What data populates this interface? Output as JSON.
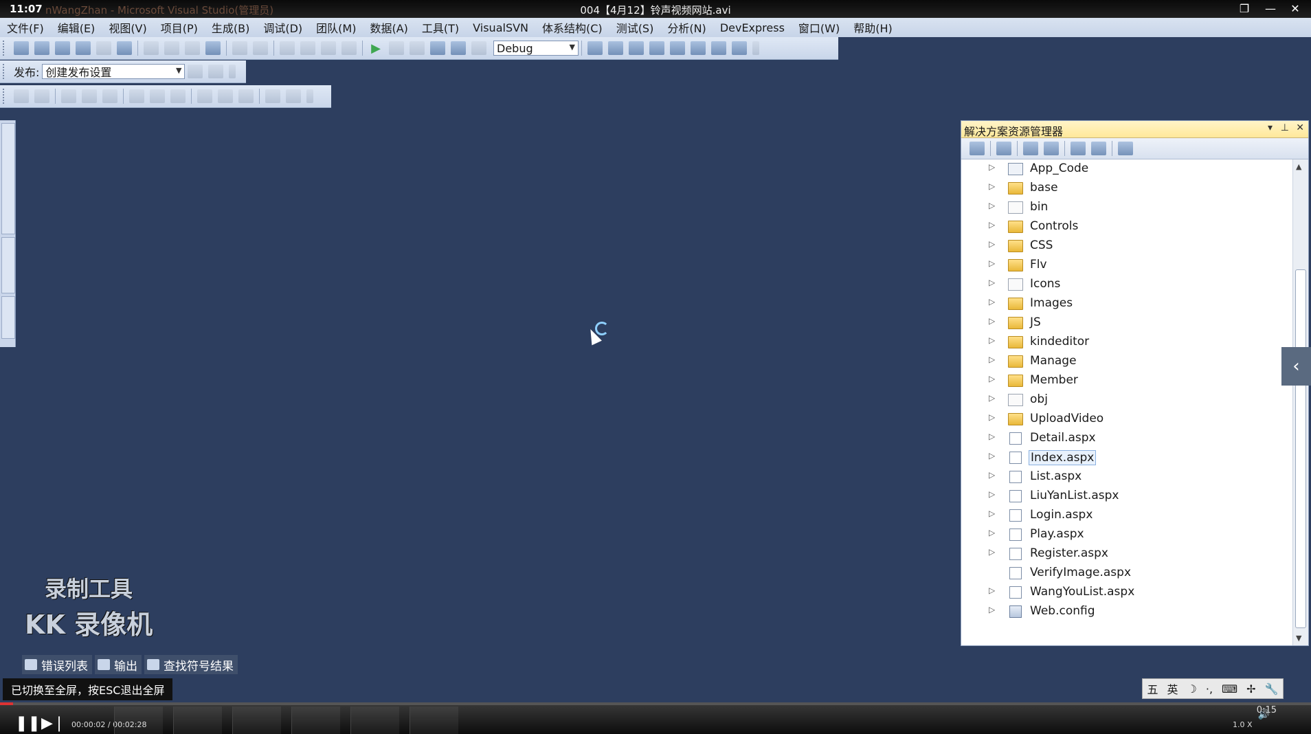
{
  "titlebar": {
    "clock": "11:07",
    "ghost_title": "nWangZhan - Microsoft Visual Studio(管理员)",
    "title": "004【4月12】铃声视频网站.avi"
  },
  "menu": [
    "文件(F)",
    "编辑(E)",
    "视图(V)",
    "项目(P)",
    "生成(B)",
    "调试(D)",
    "团队(M)",
    "数据(A)",
    "工具(T)",
    "VisualSVN",
    "体系结构(C)",
    "测试(S)",
    "分析(N)",
    "DevExpress",
    "窗口(W)",
    "帮助(H)"
  ],
  "toolbar1": {
    "config": "Debug"
  },
  "toolbar2": {
    "publish_label": "发布:",
    "publish_value": "创建发布设置"
  },
  "solution_explorer": {
    "title": "解决方案资源管理器",
    "items": [
      {
        "name": "App_Code",
        "type": "special",
        "expandable": true
      },
      {
        "name": "base",
        "type": "folder",
        "expandable": true
      },
      {
        "name": "bin",
        "type": "folder-empty",
        "expandable": true
      },
      {
        "name": "Controls",
        "type": "folder",
        "expandable": true
      },
      {
        "name": "CSS",
        "type": "folder",
        "expandable": true
      },
      {
        "name": "Flv",
        "type": "folder",
        "expandable": true
      },
      {
        "name": "Icons",
        "type": "folder-empty",
        "expandable": true
      },
      {
        "name": "Images",
        "type": "folder",
        "expandable": true
      },
      {
        "name": "JS",
        "type": "folder",
        "expandable": true
      },
      {
        "name": "kindeditor",
        "type": "folder",
        "expandable": true
      },
      {
        "name": "Manage",
        "type": "folder",
        "expandable": true
      },
      {
        "name": "Member",
        "type": "folder",
        "expandable": true
      },
      {
        "name": "obj",
        "type": "folder-empty",
        "expandable": true
      },
      {
        "name": "UploadVideo",
        "type": "folder",
        "expandable": true
      },
      {
        "name": "Detail.aspx",
        "type": "file",
        "expandable": true
      },
      {
        "name": "Index.aspx",
        "type": "file",
        "expandable": true,
        "selected": true
      },
      {
        "name": "List.aspx",
        "type": "file",
        "expandable": true
      },
      {
        "name": "LiuYanList.aspx",
        "type": "file",
        "expandable": true
      },
      {
        "name": "Login.aspx",
        "type": "file",
        "expandable": true
      },
      {
        "name": "Play.aspx",
        "type": "file",
        "expandable": true
      },
      {
        "name": "Register.aspx",
        "type": "file",
        "expandable": true
      },
      {
        "name": "VerifyImage.aspx",
        "type": "file",
        "expandable": false
      },
      {
        "name": "WangYouList.aspx",
        "type": "file",
        "expandable": true
      },
      {
        "name": "Web.config",
        "type": "config",
        "expandable": true
      }
    ]
  },
  "watermark": {
    "line1": "录制工具",
    "line2": "KK 录像机"
  },
  "bottom_tabs": [
    "错误列表",
    "输出",
    "查找符号结果"
  ],
  "notice": "已切换至全屏，按ESC退出全屏",
  "ime": [
    "五",
    "英",
    "☽",
    "·,",
    "⌨",
    "✢",
    "🔧"
  ],
  "player": {
    "time": "00:00:02 / 00:02:28",
    "speed": "1.0 X",
    "clock": "0:15",
    "progress_percent": 1
  }
}
